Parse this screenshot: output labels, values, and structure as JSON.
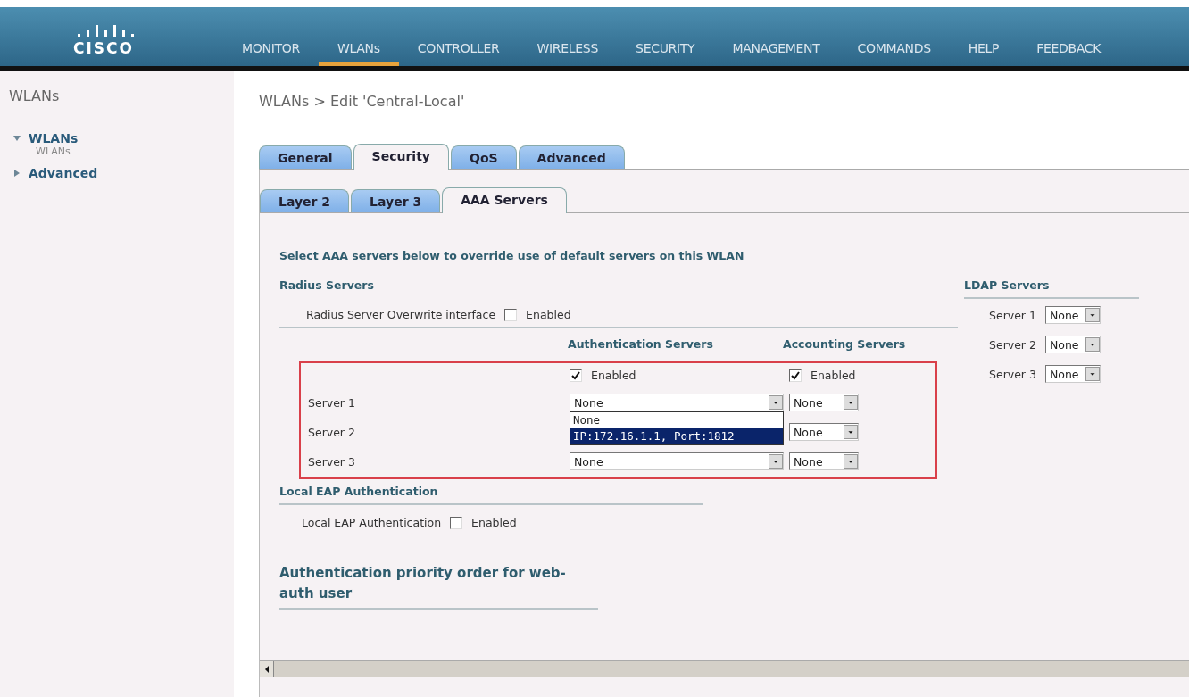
{
  "header": {
    "logo": "CISCO",
    "nav": [
      {
        "label": "MONITOR",
        "selected": false
      },
      {
        "label": "WLANs",
        "selected": true
      },
      {
        "label": "CONTROLLER",
        "selected": false
      },
      {
        "label": "WIRELESS",
        "selected": false
      },
      {
        "label": "SECURITY",
        "selected": false
      },
      {
        "label": "MANAGEMENT",
        "selected": false
      },
      {
        "label": "COMMANDS",
        "selected": false
      },
      {
        "label": "HELP",
        "selected": false
      },
      {
        "label": "FEEDBACK",
        "selected": false
      }
    ]
  },
  "sidebar": {
    "title": "WLANs",
    "items": [
      {
        "label": "WLANs",
        "expanded": true,
        "children": [
          {
            "label": "WLANs"
          }
        ]
      },
      {
        "label": "Advanced",
        "expanded": false
      }
    ]
  },
  "page_title": "WLANs > Edit  'Central-Local'",
  "tabs": [
    {
      "label": "General",
      "selected": false
    },
    {
      "label": "Security",
      "selected": true
    },
    {
      "label": "QoS",
      "selected": false
    },
    {
      "label": "Advanced",
      "selected": false
    }
  ],
  "subtabs": [
    {
      "label": "Layer 2",
      "selected": false
    },
    {
      "label": "Layer 3",
      "selected": false
    },
    {
      "label": "AAA Servers",
      "selected": true
    }
  ],
  "intro": "Select AAA servers below to override use of default servers on this WLAN",
  "radius": {
    "heading": "Radius Servers",
    "overwrite": {
      "label": "Radius Server Overwrite interface",
      "option": "Enabled",
      "checked": false
    },
    "columns": [
      "Authentication Servers",
      "Accounting Servers"
    ],
    "enable": [
      {
        "label": "Enabled",
        "checked": true
      },
      {
        "label": "Enabled",
        "checked": true
      }
    ],
    "servers": [
      {
        "label": "Server 1",
        "auth": "None",
        "accounting": "None"
      },
      {
        "label": "Server 2",
        "accounting": "None"
      },
      {
        "label": "Server 3",
        "auth": "None",
        "accounting": "None"
      }
    ],
    "dropdown": {
      "options": [
        {
          "label": "None",
          "selected": false
        },
        {
          "label": "IP:172.16.1.1, Port:1812",
          "selected": true
        }
      ]
    }
  },
  "ldap": {
    "heading": "LDAP Servers",
    "servers": [
      {
        "label": "Server 1",
        "value": "None"
      },
      {
        "label": "Server 2",
        "value": "None"
      },
      {
        "label": "Server 3",
        "value": "None"
      }
    ]
  },
  "local_eap": {
    "heading": "Local EAP Authentication",
    "label": "Local EAP Authentication",
    "option": "Enabled",
    "checked": false
  },
  "priority": {
    "heading": "Authentication priority order for web-auth user"
  }
}
